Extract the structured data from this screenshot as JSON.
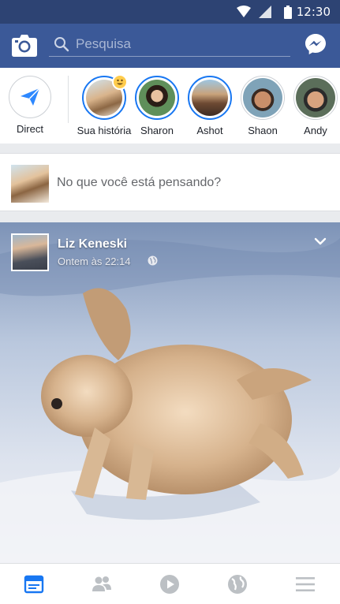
{
  "status_bar": {
    "time": "12:30"
  },
  "header": {
    "search_placeholder": "Pesquisa"
  },
  "stories": [
    {
      "label": "Direct"
    },
    {
      "label": "Sua história"
    },
    {
      "label": "Sharon"
    },
    {
      "label": "Ashot"
    },
    {
      "label": "Shaon"
    },
    {
      "label": "Andy"
    }
  ],
  "composer": {
    "prompt": "No que você está pensando?"
  },
  "post": {
    "author": "Liz Keneski",
    "timestamp": "Ontem às 22:14"
  },
  "colors": {
    "brand": "#3b5998",
    "status_bar": "#2d4373",
    "story_ring": "#1877f2"
  },
  "icons": {
    "camera": "camera-icon",
    "search": "search-icon",
    "messenger": "messenger-icon",
    "direct": "paper-plane-icon",
    "privacy": "globe-icon",
    "menu": "chevron-down-icon",
    "nav": [
      "news-feed-icon",
      "friends-icon",
      "video-icon",
      "globe-icon",
      "menu-icon"
    ]
  }
}
